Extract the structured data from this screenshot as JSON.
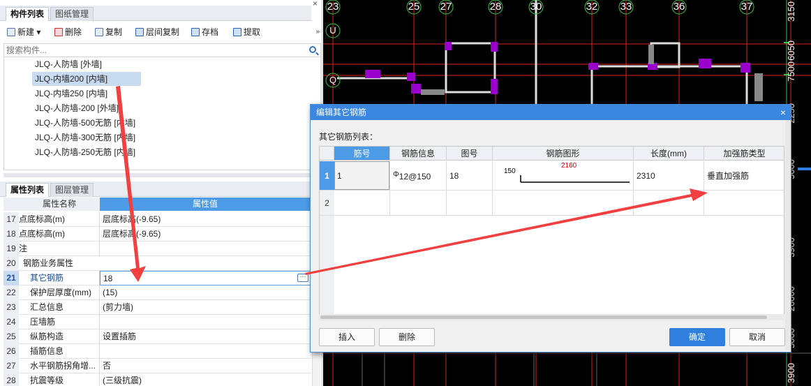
{
  "left_panel": {
    "top_tabs": [
      "构件列表",
      "图纸管理"
    ],
    "toolbar": [
      "新建",
      "删除",
      "复制",
      "层间复制",
      "存档",
      "提取"
    ],
    "search_placeholder": "搜索构件...",
    "components": [
      "JLQ-人防墙 [外墙]",
      "JLQ-内墙200 [内墙]",
      "JLQ-内墙250 [内墙]",
      "JLQ-人防墙-200 [外墙]",
      "JLQ-人防墙-500无筋 [内墙]",
      "JLQ-人防墙-300无筋 [内墙]",
      "JLQ-人防墙-250无筋 [内墙]"
    ],
    "selected_component": 1,
    "bottom_tabs": [
      "属性列表",
      "图层管理"
    ],
    "prop_headers": [
      "属性名称",
      "属性值"
    ],
    "properties": [
      {
        "num": "17",
        "name": "点底标高(m)",
        "value": "层底标高(-9.65)"
      },
      {
        "num": "18",
        "name": "点底标高(m)",
        "value": "层底标高(-9.65)"
      },
      {
        "num": "19",
        "name": "注",
        "value": ""
      },
      {
        "num": "20",
        "name": "钢筋业务属性",
        "value": ""
      },
      {
        "num": "21",
        "name": "其它钢筋",
        "value": "18"
      },
      {
        "num": "22",
        "name": "保护层厚度(mm)",
        "value": "(15)"
      },
      {
        "num": "23",
        "name": "汇总信息",
        "value": "(剪力墙)"
      },
      {
        "num": "24",
        "name": "压墙筋",
        "value": ""
      },
      {
        "num": "25",
        "name": "纵筋构造",
        "value": "设置插筋"
      },
      {
        "num": "26",
        "name": "插筋信息",
        "value": ""
      },
      {
        "num": "27",
        "name": "水平钢筋拐角增...",
        "value": "否"
      },
      {
        "num": "28",
        "name": "抗震等级",
        "value": "(三级抗震)"
      }
    ]
  },
  "cad": {
    "axis_labels": [
      "23",
      "25",
      "27",
      "28",
      "30",
      "32",
      "33",
      "36",
      "37"
    ],
    "row_labels": [
      "U",
      "Q"
    ],
    "right_dims": [
      "3150",
      "6050",
      "7500",
      "2250",
      "5600",
      "3900",
      "26000",
      "3900"
    ],
    "right_dims_extra": "5000"
  },
  "dialog": {
    "title": "编辑其它钢筋",
    "close": "×",
    "list_label": "其它钢筋列表：",
    "columns": [
      "筋号",
      "钢筋信息",
      "图号",
      "钢筋图形",
      "长度(mm)",
      "加强筋类型"
    ],
    "rows": [
      {
        "no": "1",
        "jinhao": "1",
        "info": "12@150",
        "tuhao": "18",
        "shape_left": "150",
        "shape_len": "2160",
        "length": "2310",
        "type": "垂直加强筋"
      },
      {
        "no": "2",
        "jinhao": "",
        "info": "",
        "tuhao": "",
        "shape_left": "",
        "shape_len": "",
        "length": "",
        "type": ""
      }
    ],
    "rebar_symbol": "Φ",
    "buttons": {
      "insert": "插入",
      "delete": "删除",
      "ok": "确定",
      "cancel": "取消"
    }
  }
}
